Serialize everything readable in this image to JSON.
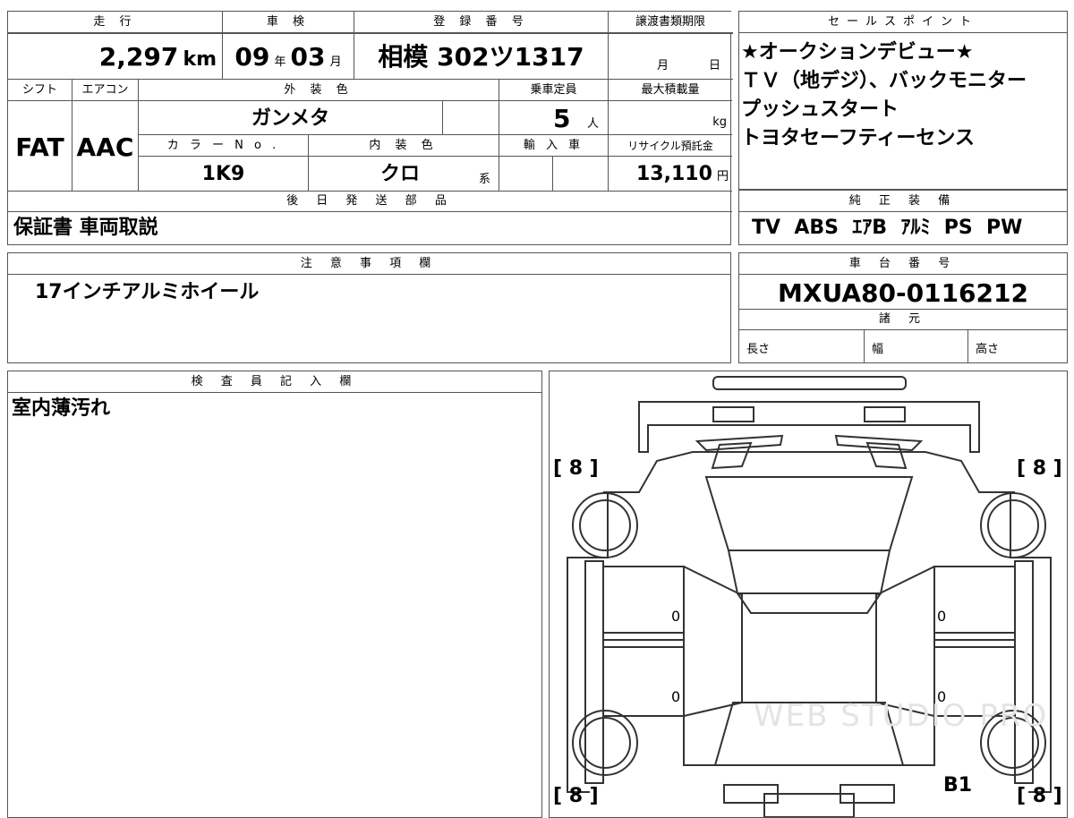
{
  "top_table": {
    "headers": {
      "mileage": "走 行",
      "inspection": "車 検",
      "reg_no": "登 録 番 号",
      "transfer_deadline": "譲渡書類期限",
      "shift": "シフト",
      "aircon": "エアコン",
      "exterior_color": "外 装 色",
      "capacity": "乗車定員",
      "max_load": "最大積載量",
      "color_no": "カ ラ ー N o .",
      "interior_color": "内 装 色",
      "import": "輸 入 車",
      "recycle": "リサイクル預託金"
    },
    "mileage_value": "2,297",
    "mileage_unit": "km",
    "inspection_year": "09",
    "inspection_year_unit": "年",
    "inspection_month": "03",
    "inspection_month_unit": "月",
    "reg_no_value": "相模 302ツ1317",
    "deadline_month_unit": "月",
    "deadline_day_unit": "日",
    "shift_value": "FAT",
    "aircon_value": "AAC",
    "exterior_color_value": "ガンメタ",
    "capacity_value": "5",
    "capacity_unit": "人",
    "max_load_unit": "kg",
    "color_no_value": "1K9",
    "interior_color_value": "クロ",
    "interior_color_suffix": "系",
    "recycle_value": "13,110",
    "recycle_unit": "円"
  },
  "later_parts": {
    "header": "後 日 発 送 部 品",
    "value": "保証書 車両取説"
  },
  "notes": {
    "header": "注 意 事 項 欄",
    "value": "17インチアルミホイール"
  },
  "inspector": {
    "header": "検 査 員 記 入 欄",
    "value": "室内薄汚れ"
  },
  "sales_points": {
    "header": "セールスポイント",
    "lines": [
      "★オークションデビュー★",
      "ＴＶ（地デジ）、バックモニター",
      "プッシュスタート",
      "トヨタセーフティーセンス"
    ]
  },
  "equipment": {
    "header": "純 正 装 備",
    "value": "TV  ABS  ｴｱB  ｱﾙﾐ  PS  PW"
  },
  "chassis": {
    "header": "車 台 番 号",
    "value": "MXUA80-0116212"
  },
  "specs": {
    "header": "諸 元",
    "length": "長さ",
    "width": "幅",
    "height": "高さ"
  },
  "diagram": {
    "tire_fl": "[ 8 ]",
    "tire_fr": "[ 8 ]",
    "tire_rl": "[ 8 ]",
    "tire_rr": "[ 8 ]",
    "front_left_door": "0",
    "front_right_door": "0",
    "rear_left_door": "0",
    "rear_right_door": "0",
    "damage_mark": "B1",
    "watermark": "WEB STUDIO PRO"
  }
}
